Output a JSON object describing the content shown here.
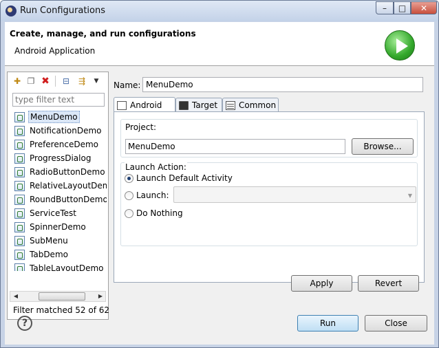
{
  "window": {
    "title": "Run Configurations",
    "controls": {
      "minimize": "–",
      "maximize": "□",
      "close": "✕"
    }
  },
  "header": {
    "title": "Create, manage, and run configurations",
    "subtitle": "Android Application",
    "banner_icon": "run-play-icon"
  },
  "left_panel": {
    "toolbar": [
      {
        "name": "new-configuration",
        "icon": "new-config-icon",
        "glyph": "✚"
      },
      {
        "name": "duplicate",
        "icon": "duplicate-icon",
        "glyph": "❐"
      },
      {
        "name": "delete",
        "icon": "delete-icon",
        "glyph": "✖"
      },
      {
        "name": "collapse-all",
        "icon": "collapse-all-icon",
        "glyph": "⊟"
      },
      {
        "name": "filter",
        "icon": "filter-icon",
        "glyph": "⇶"
      },
      {
        "name": "view-menu",
        "icon": "view-menu-icon",
        "glyph": "▼"
      }
    ],
    "filter_placeholder": "type filter text",
    "items": [
      "MenuDemo",
      "NotificationDemo",
      "PreferenceDemo",
      "ProgressDialog",
      "RadioButtonDemo",
      "RelativeLayoutDem",
      "RoundButtonDemo",
      "ServiceTest",
      "SpinnerDemo",
      "SubMenu",
      "TabDemo",
      "TableLayoutDemo"
    ],
    "selected_item": "MenuDemo",
    "filter_status": "Filter matched 52 of 62"
  },
  "config": {
    "name_label": "Name:",
    "name_value": "MenuDemo",
    "tabs": [
      {
        "label": "Android",
        "icon": "android-tab-icon",
        "active": true
      },
      {
        "label": "Target",
        "icon": "monitor-icon",
        "active": false
      },
      {
        "label": "Common",
        "icon": "table-icon",
        "active": false
      }
    ],
    "project_label": "Project:",
    "project_value": "MenuDemo",
    "browse_label": "Browse...",
    "launch_action_label": "Launch Action:",
    "options": [
      {
        "label": "Launch Default Activity",
        "checked": true
      },
      {
        "label": "Launch:",
        "checked": false
      },
      {
        "label": "Do Nothing",
        "checked": false
      }
    ],
    "launch_select_value": ""
  },
  "buttons": {
    "apply": "Apply",
    "revert": "Revert",
    "run": "Run",
    "close": "Close"
  },
  "colors": {
    "title_bar": "#c3d2e8",
    "selection": "#dbe7f7",
    "run_icon": "#33a82b"
  }
}
